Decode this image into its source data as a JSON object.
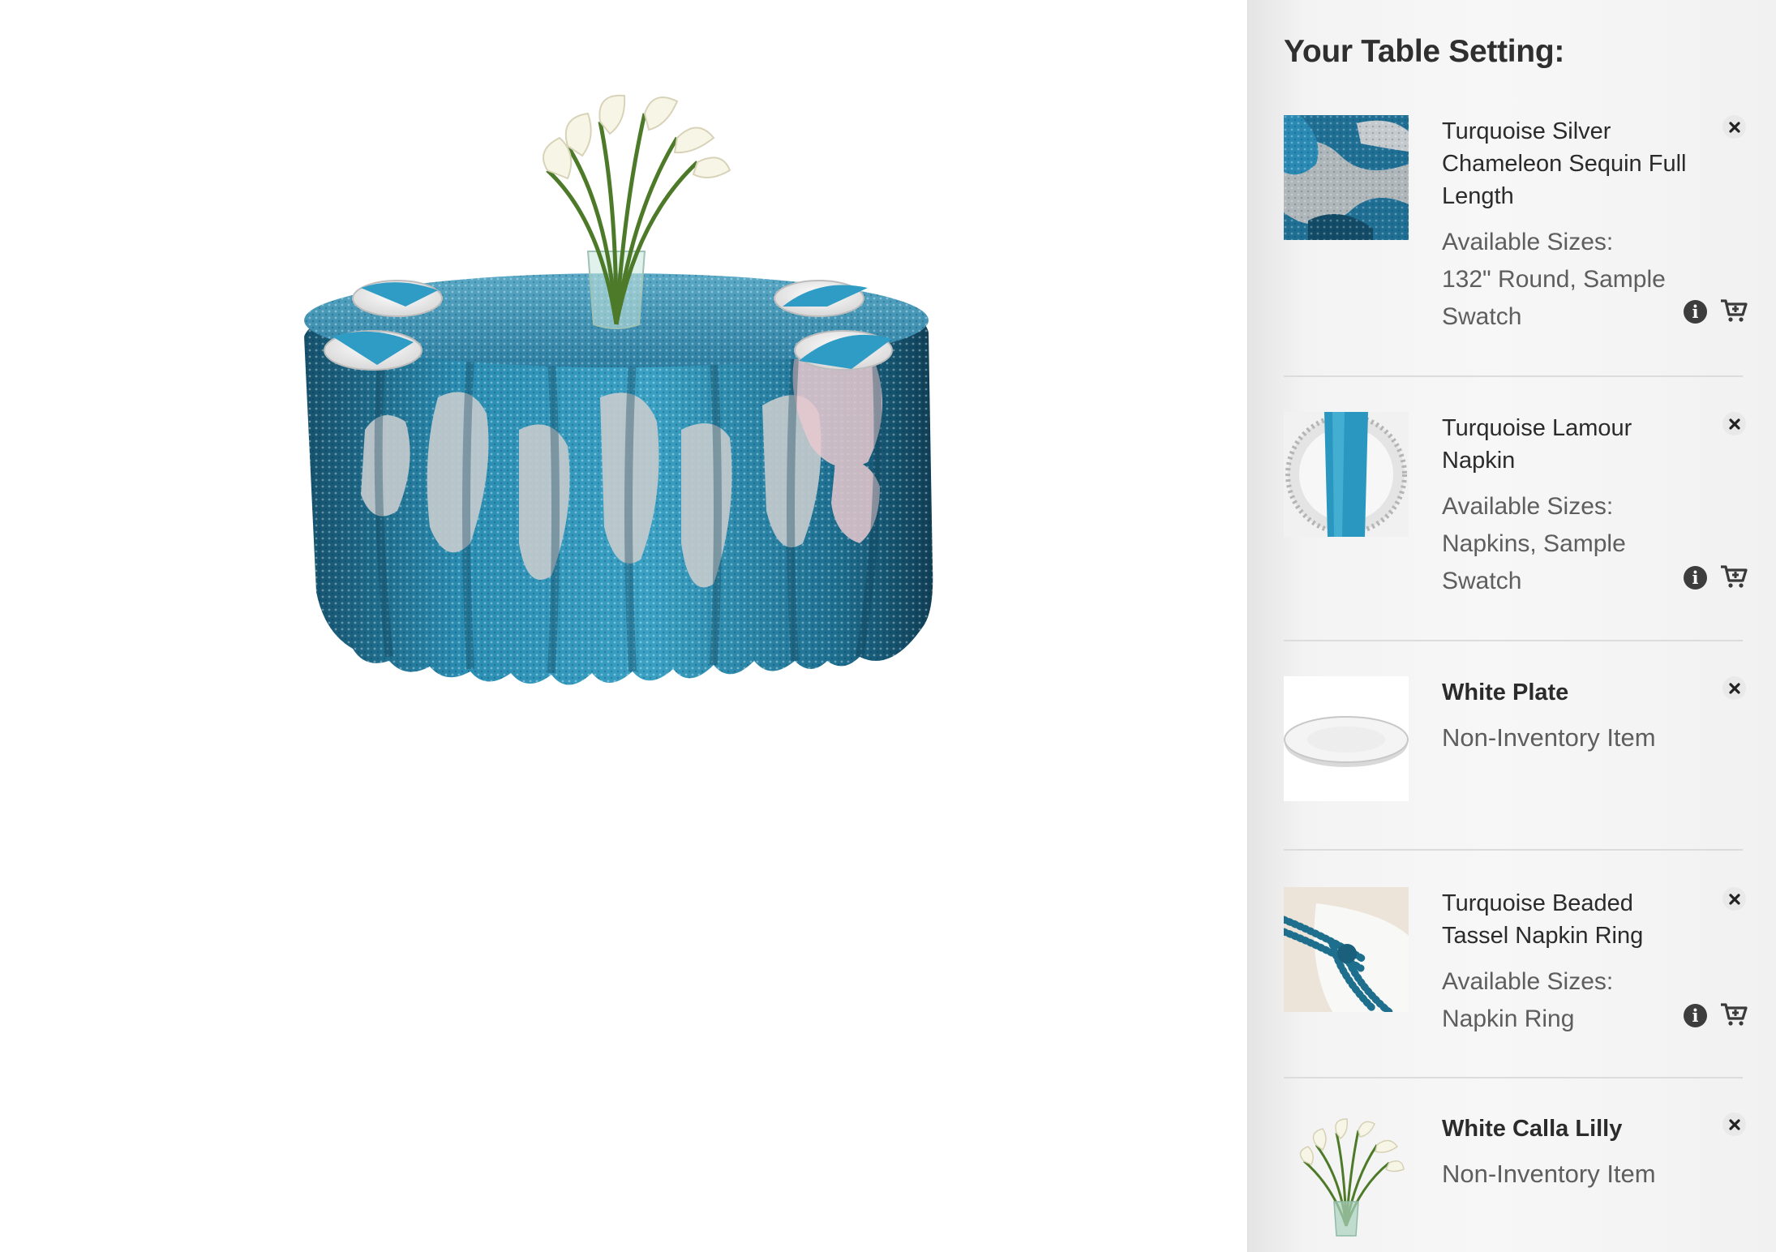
{
  "panel": {
    "title": "Your Table Setting:"
  },
  "items": [
    {
      "name": "Turquoise Silver Chameleon Sequin Full Length",
      "sizes_label": "Available Sizes:",
      "sizes": "132\" Round, Sample Swatch",
      "thumb_icon": "sequin-fabric-swatch"
    },
    {
      "name": "Turquoise Lamour Napkin",
      "sizes_label": "Available Sizes:",
      "sizes": "Napkins, Sample Swatch",
      "thumb_icon": "napkin-on-charger"
    },
    {
      "name": "White Plate",
      "note": "Non-Inventory Item",
      "thumb_icon": "white-plate"
    },
    {
      "name": "Turquoise Beaded Tassel Napkin Ring",
      "sizes_label": "Available Sizes:",
      "sizes": "Napkin Ring",
      "thumb_icon": "beaded-napkin-ring"
    },
    {
      "name": "White Calla Lilly",
      "note": "Non-Inventory Item",
      "thumb_icon": "calla-lily-vase"
    }
  ],
  "colors": {
    "turquoise": "#2c93b6",
    "sequin_silver": "#c9cdcf",
    "panel_bg": "#f5f5f5",
    "text_dark": "#2b2b2b",
    "text_muted": "#5e5e5e"
  }
}
